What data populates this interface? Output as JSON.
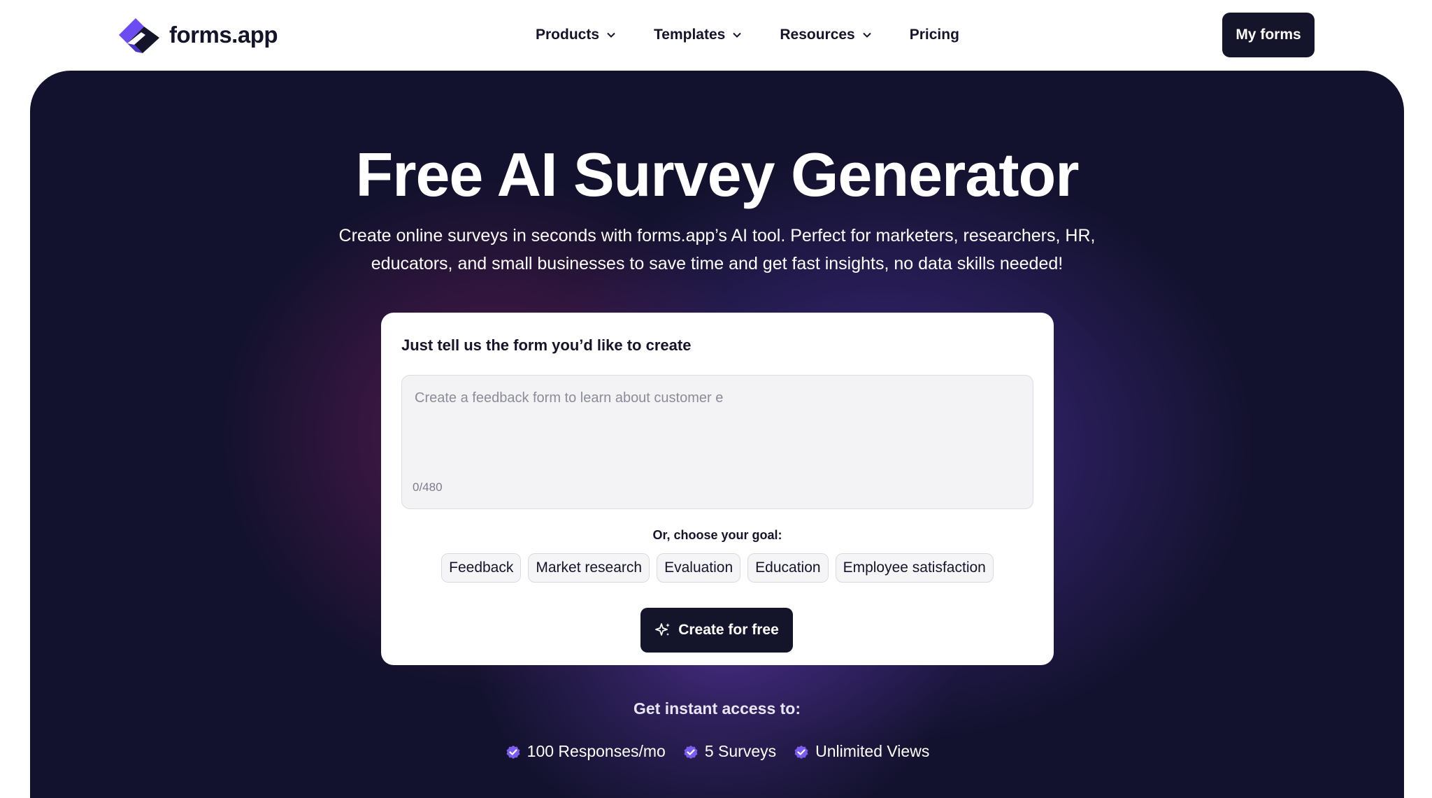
{
  "brand": {
    "name": "forms.app",
    "colors": {
      "primary": "#14142b",
      "accent": "#7b5cf0",
      "hero_bg": "#13122e"
    }
  },
  "nav": {
    "items": [
      {
        "label": "Products",
        "has_dropdown": true
      },
      {
        "label": "Templates",
        "has_dropdown": true
      },
      {
        "label": "Resources",
        "has_dropdown": true
      },
      {
        "label": "Pricing",
        "has_dropdown": false
      }
    ],
    "cta_label": "My forms"
  },
  "hero": {
    "title": "Free AI Survey Generator",
    "subtitle_line1": "Create online surveys in seconds with forms.app’s AI tool. Perfect for marketers, researchers, HR,",
    "subtitle_line2": "educators, and small businesses to save time and get fast insights, no data skills needed!"
  },
  "generator": {
    "label": "Just tell us the form you’d like to create",
    "input_value": "",
    "input_placeholder": "Create a feedback form to learn about customer e",
    "char_count": "0/480",
    "goal_label": "Or, choose your goal:",
    "goals": [
      "Feedback",
      "Market research",
      "Evaluation",
      "Education",
      "Employee satisfaction"
    ],
    "submit_label": "Create for free",
    "submit_icon": "sparkle-icon"
  },
  "access": {
    "title": "Get instant access to:",
    "perks": [
      {
        "icon": "verified-check-icon",
        "label": "100 Responses/mo"
      },
      {
        "icon": "verified-check-icon",
        "label": "5 Surveys"
      },
      {
        "icon": "verified-check-icon",
        "label": "Unlimited Views"
      }
    ]
  }
}
